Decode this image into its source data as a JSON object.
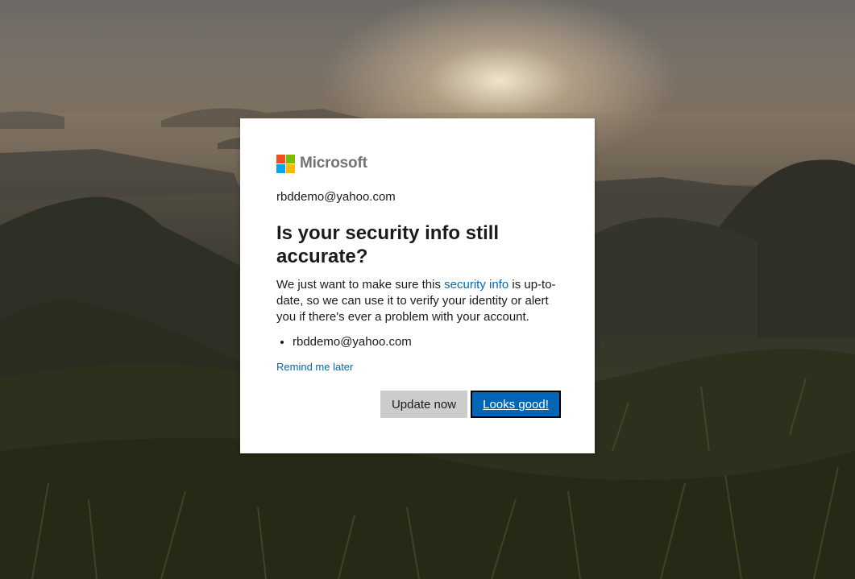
{
  "brand": {
    "name": "Microsoft",
    "logo_colors": [
      "#f25022",
      "#7fba00",
      "#00a4ef",
      "#ffb900"
    ]
  },
  "account": "rbddemo@yahoo.com",
  "title": "Is your security info still accurate?",
  "description": {
    "before_link": "We just want to make sure this ",
    "link": "security info",
    "after_link": " is up-to-date, so we can use it to verify your identity or alert you if there's ever a problem with your account."
  },
  "security_items": [
    "rbddemo@yahoo.com"
  ],
  "remind_link": "Remind me later",
  "buttons": {
    "update": "Update now",
    "confirm": "Looks good!"
  },
  "colors": {
    "accent": "#0067b8",
    "secondary_button": "#cccccc"
  }
}
